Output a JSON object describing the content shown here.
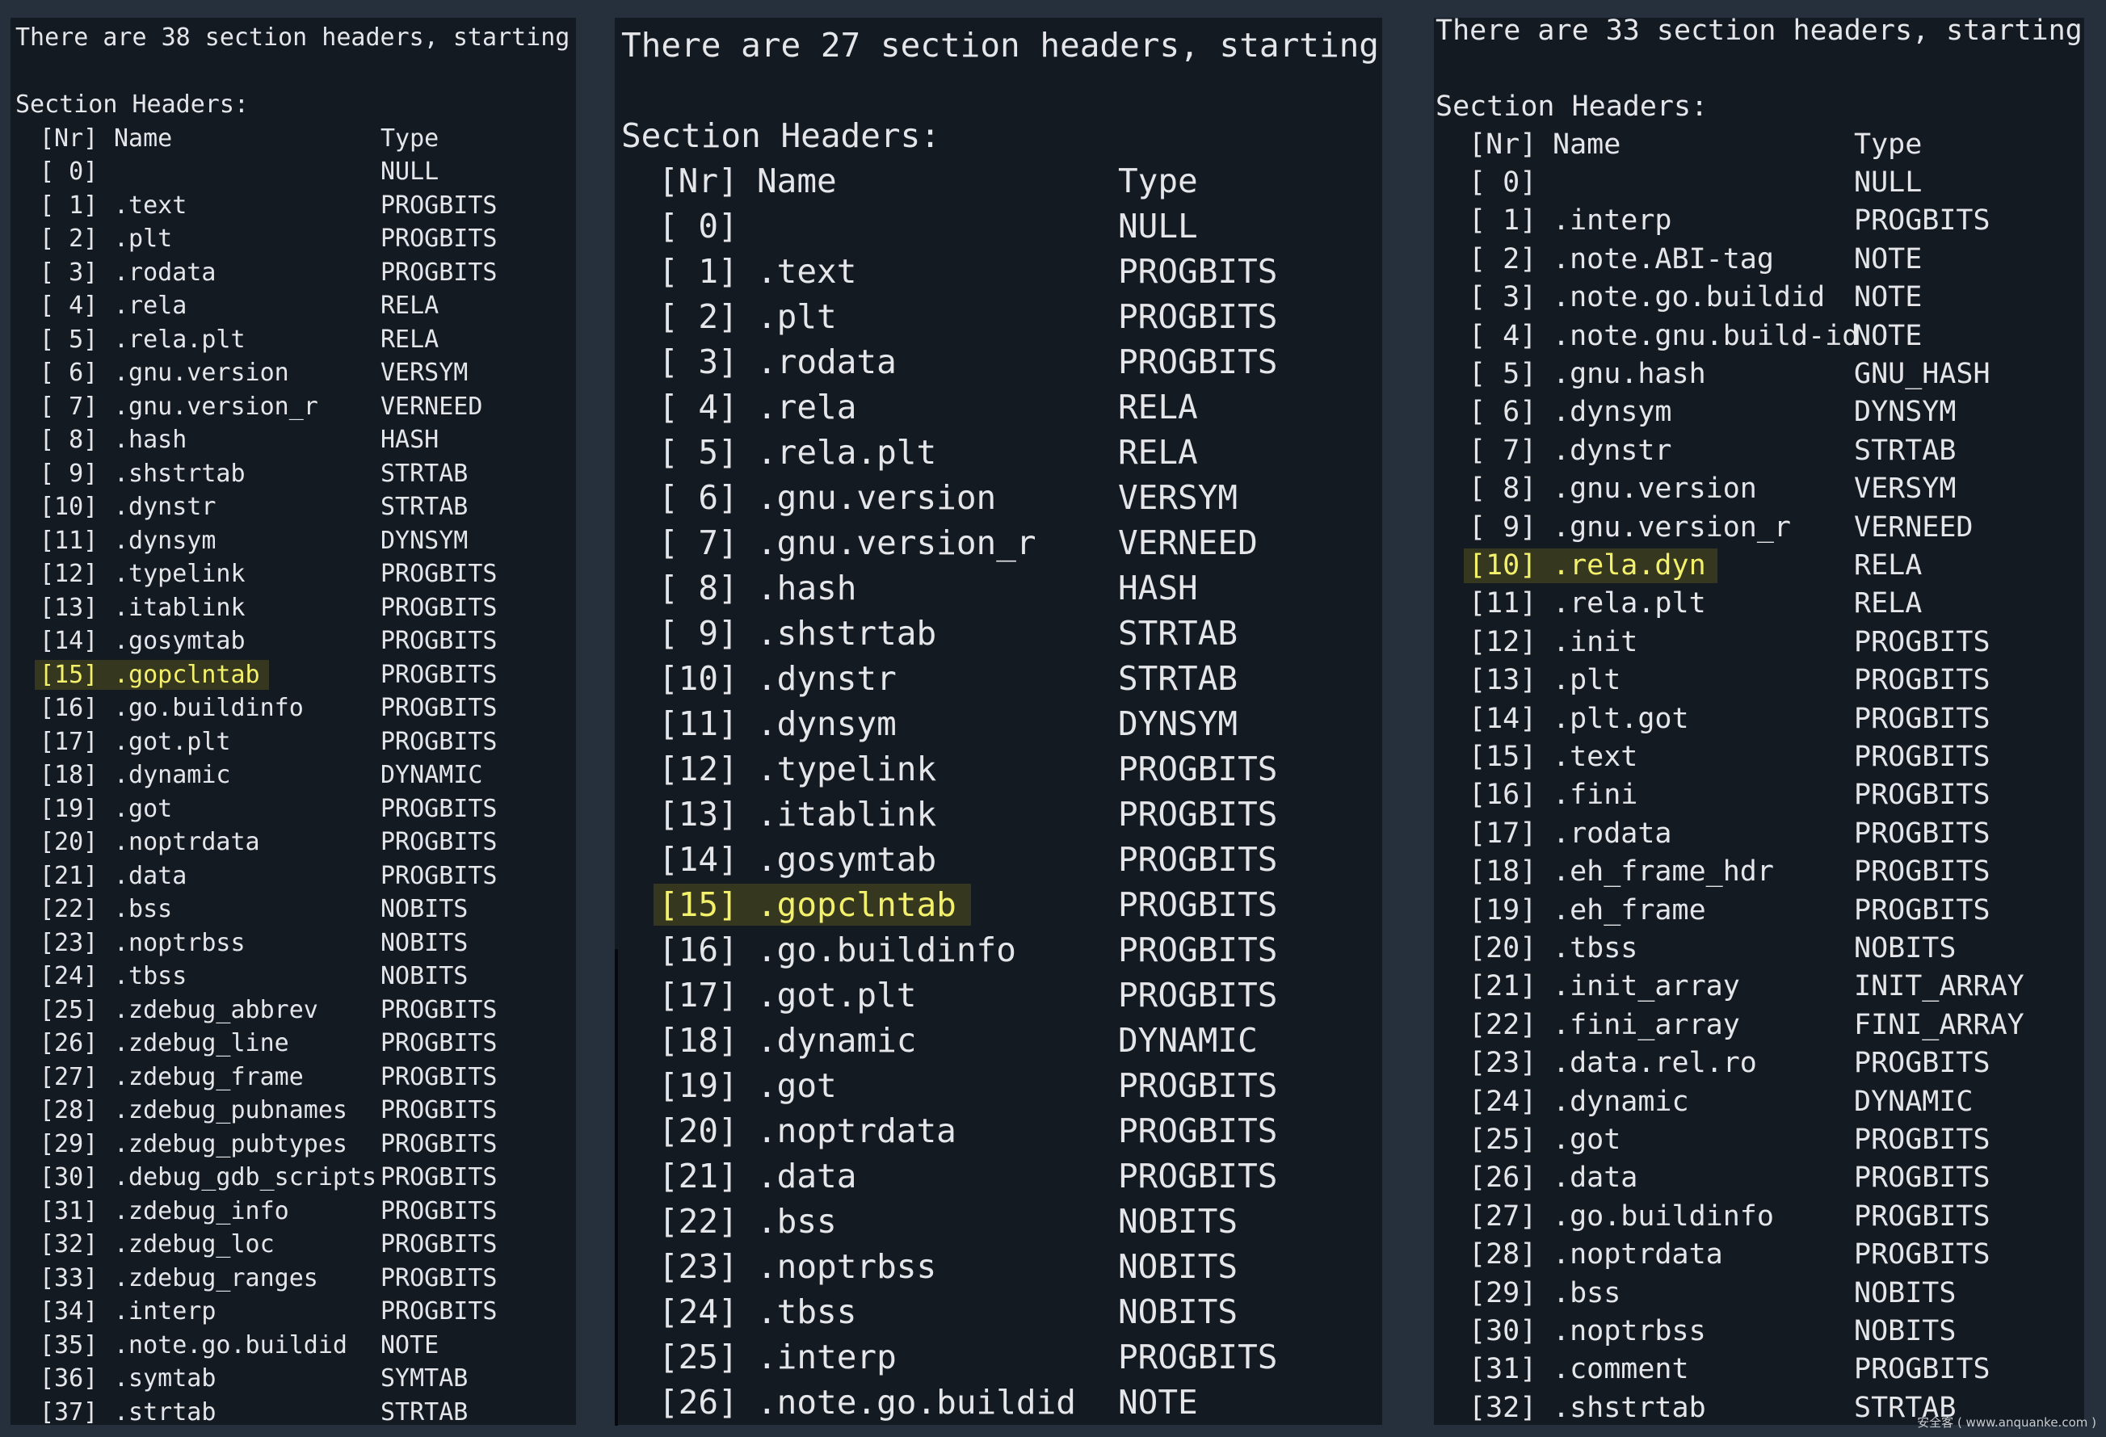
{
  "panels": [
    {
      "summary": "There are 38 section headers, starting",
      "heading": "Section Headers:",
      "columns": {
        "nr": "[Nr]",
        "name": "Name",
        "type": "Type"
      },
      "rows": [
        {
          "nr": "[ 0]",
          "name": "",
          "type": "NULL"
        },
        {
          "nr": "[ 1]",
          "name": ".text",
          "type": "PROGBITS"
        },
        {
          "nr": "[ 2]",
          "name": ".plt",
          "type": "PROGBITS"
        },
        {
          "nr": "[ 3]",
          "name": ".rodata",
          "type": "PROGBITS"
        },
        {
          "nr": "[ 4]",
          "name": ".rela",
          "type": "RELA"
        },
        {
          "nr": "[ 5]",
          "name": ".rela.plt",
          "type": "RELA"
        },
        {
          "nr": "[ 6]",
          "name": ".gnu.version",
          "type": "VERSYM"
        },
        {
          "nr": "[ 7]",
          "name": ".gnu.version_r",
          "type": "VERNEED"
        },
        {
          "nr": "[ 8]",
          "name": ".hash",
          "type": "HASH"
        },
        {
          "nr": "[ 9]",
          "name": ".shstrtab",
          "type": "STRTAB"
        },
        {
          "nr": "[10]",
          "name": ".dynstr",
          "type": "STRTAB"
        },
        {
          "nr": "[11]",
          "name": ".dynsym",
          "type": "DYNSYM"
        },
        {
          "nr": "[12]",
          "name": ".typelink",
          "type": "PROGBITS"
        },
        {
          "nr": "[13]",
          "name": ".itablink",
          "type": "PROGBITS"
        },
        {
          "nr": "[14]",
          "name": ".gosymtab",
          "type": "PROGBITS"
        },
        {
          "nr": "[15]",
          "name": ".gopclntab",
          "type": "PROGBITS",
          "highlight": true
        },
        {
          "nr": "[16]",
          "name": ".go.buildinfo",
          "type": "PROGBITS"
        },
        {
          "nr": "[17]",
          "name": ".got.plt",
          "type": "PROGBITS"
        },
        {
          "nr": "[18]",
          "name": ".dynamic",
          "type": "DYNAMIC"
        },
        {
          "nr": "[19]",
          "name": ".got",
          "type": "PROGBITS"
        },
        {
          "nr": "[20]",
          "name": ".noptrdata",
          "type": "PROGBITS"
        },
        {
          "nr": "[21]",
          "name": ".data",
          "type": "PROGBITS"
        },
        {
          "nr": "[22]",
          "name": ".bss",
          "type": "NOBITS"
        },
        {
          "nr": "[23]",
          "name": ".noptrbss",
          "type": "NOBITS"
        },
        {
          "nr": "[24]",
          "name": ".tbss",
          "type": "NOBITS"
        },
        {
          "nr": "[25]",
          "name": ".zdebug_abbrev",
          "type": "PROGBITS"
        },
        {
          "nr": "[26]",
          "name": ".zdebug_line",
          "type": "PROGBITS"
        },
        {
          "nr": "[27]",
          "name": ".zdebug_frame",
          "type": "PROGBITS"
        },
        {
          "nr": "[28]",
          "name": ".zdebug_pubnames",
          "type": "PROGBITS"
        },
        {
          "nr": "[29]",
          "name": ".zdebug_pubtypes",
          "type": "PROGBITS"
        },
        {
          "nr": "[30]",
          "name": ".debug_gdb_scripts",
          "type": "PROGBITS"
        },
        {
          "nr": "[31]",
          "name": ".zdebug_info",
          "type": "PROGBITS"
        },
        {
          "nr": "[32]",
          "name": ".zdebug_loc",
          "type": "PROGBITS"
        },
        {
          "nr": "[33]",
          "name": ".zdebug_ranges",
          "type": "PROGBITS"
        },
        {
          "nr": "[34]",
          "name": ".interp",
          "type": "PROGBITS"
        },
        {
          "nr": "[35]",
          "name": ".note.go.buildid",
          "type": "NOTE"
        },
        {
          "nr": "[36]",
          "name": ".symtab",
          "type": "SYMTAB"
        },
        {
          "nr": "[37]",
          "name": ".strtab",
          "type": "STRTAB"
        }
      ]
    },
    {
      "summary": "There are 27 section headers, starting",
      "heading": "Section Headers:",
      "columns": {
        "nr": "[Nr]",
        "name": "Name",
        "type": "Type"
      },
      "rows": [
        {
          "nr": "[ 0]",
          "name": "",
          "type": "NULL"
        },
        {
          "nr": "[ 1]",
          "name": ".text",
          "type": "PROGBITS"
        },
        {
          "nr": "[ 2]",
          "name": ".plt",
          "type": "PROGBITS"
        },
        {
          "nr": "[ 3]",
          "name": ".rodata",
          "type": "PROGBITS"
        },
        {
          "nr": "[ 4]",
          "name": ".rela",
          "type": "RELA"
        },
        {
          "nr": "[ 5]",
          "name": ".rela.plt",
          "type": "RELA"
        },
        {
          "nr": "[ 6]",
          "name": ".gnu.version",
          "type": "VERSYM"
        },
        {
          "nr": "[ 7]",
          "name": ".gnu.version_r",
          "type": "VERNEED"
        },
        {
          "nr": "[ 8]",
          "name": ".hash",
          "type": "HASH"
        },
        {
          "nr": "[ 9]",
          "name": ".shstrtab",
          "type": "STRTAB"
        },
        {
          "nr": "[10]",
          "name": ".dynstr",
          "type": "STRTAB"
        },
        {
          "nr": "[11]",
          "name": ".dynsym",
          "type": "DYNSYM"
        },
        {
          "nr": "[12]",
          "name": ".typelink",
          "type": "PROGBITS"
        },
        {
          "nr": "[13]",
          "name": ".itablink",
          "type": "PROGBITS"
        },
        {
          "nr": "[14]",
          "name": ".gosymtab",
          "type": "PROGBITS"
        },
        {
          "nr": "[15]",
          "name": ".gopclntab",
          "type": "PROGBITS",
          "highlight": true
        },
        {
          "nr": "[16]",
          "name": ".go.buildinfo",
          "type": "PROGBITS"
        },
        {
          "nr": "[17]",
          "name": ".got.plt",
          "type": "PROGBITS"
        },
        {
          "nr": "[18]",
          "name": ".dynamic",
          "type": "DYNAMIC"
        },
        {
          "nr": "[19]",
          "name": ".got",
          "type": "PROGBITS"
        },
        {
          "nr": "[20]",
          "name": ".noptrdata",
          "type": "PROGBITS"
        },
        {
          "nr": "[21]",
          "name": ".data",
          "type": "PROGBITS"
        },
        {
          "nr": "[22]",
          "name": ".bss",
          "type": "NOBITS"
        },
        {
          "nr": "[23]",
          "name": ".noptrbss",
          "type": "NOBITS"
        },
        {
          "nr": "[24]",
          "name": ".tbss",
          "type": "NOBITS"
        },
        {
          "nr": "[25]",
          "name": ".interp",
          "type": "PROGBITS"
        },
        {
          "nr": "[26]",
          "name": ".note.go.buildid",
          "type": "NOTE"
        }
      ]
    },
    {
      "summary": "There are 33 section headers, starting",
      "heading": "Section Headers:",
      "columns": {
        "nr": "[Nr]",
        "name": "Name",
        "type": "Type"
      },
      "rows": [
        {
          "nr": "[ 0]",
          "name": "",
          "type": "NULL"
        },
        {
          "nr": "[ 1]",
          "name": ".interp",
          "type": "PROGBITS"
        },
        {
          "nr": "[ 2]",
          "name": ".note.ABI-tag",
          "type": "NOTE"
        },
        {
          "nr": "[ 3]",
          "name": ".note.go.buildid",
          "type": "NOTE"
        },
        {
          "nr": "[ 4]",
          "name": ".note.gnu.build-id",
          "type": "NOTE"
        },
        {
          "nr": "[ 5]",
          "name": ".gnu.hash",
          "type": "GNU_HASH"
        },
        {
          "nr": "[ 6]",
          "name": ".dynsym",
          "type": "DYNSYM"
        },
        {
          "nr": "[ 7]",
          "name": ".dynstr",
          "type": "STRTAB"
        },
        {
          "nr": "[ 8]",
          "name": ".gnu.version",
          "type": "VERSYM"
        },
        {
          "nr": "[ 9]",
          "name": ".gnu.version_r",
          "type": "VERNEED"
        },
        {
          "nr": "[10]",
          "name": ".rela.dyn",
          "type": "RELA",
          "highlight": true
        },
        {
          "nr": "[11]",
          "name": ".rela.plt",
          "type": "RELA"
        },
        {
          "nr": "[12]",
          "name": ".init",
          "type": "PROGBITS"
        },
        {
          "nr": "[13]",
          "name": ".plt",
          "type": "PROGBITS"
        },
        {
          "nr": "[14]",
          "name": ".plt.got",
          "type": "PROGBITS"
        },
        {
          "nr": "[15]",
          "name": ".text",
          "type": "PROGBITS"
        },
        {
          "nr": "[16]",
          "name": ".fini",
          "type": "PROGBITS"
        },
        {
          "nr": "[17]",
          "name": ".rodata",
          "type": "PROGBITS"
        },
        {
          "nr": "[18]",
          "name": ".eh_frame_hdr",
          "type": "PROGBITS"
        },
        {
          "nr": "[19]",
          "name": ".eh_frame",
          "type": "PROGBITS"
        },
        {
          "nr": "[20]",
          "name": ".tbss",
          "type": "NOBITS"
        },
        {
          "nr": "[21]",
          "name": ".init_array",
          "type": "INIT_ARRAY"
        },
        {
          "nr": "[22]",
          "name": ".fini_array",
          "type": "FINI_ARRAY"
        },
        {
          "nr": "[23]",
          "name": ".data.rel.ro",
          "type": "PROGBITS"
        },
        {
          "nr": "[24]",
          "name": ".dynamic",
          "type": "DYNAMIC"
        },
        {
          "nr": "[25]",
          "name": ".got",
          "type": "PROGBITS"
        },
        {
          "nr": "[26]",
          "name": ".data",
          "type": "PROGBITS"
        },
        {
          "nr": "[27]",
          "name": ".go.buildinfo",
          "type": "PROGBITS"
        },
        {
          "nr": "[28]",
          "name": ".noptrdata",
          "type": "PROGBITS"
        },
        {
          "nr": "[29]",
          "name": ".bss",
          "type": "NOBITS"
        },
        {
          "nr": "[30]",
          "name": ".noptrbss",
          "type": "NOBITS"
        },
        {
          "nr": "[31]",
          "name": ".comment",
          "type": "PROGBITS"
        },
        {
          "nr": "[32]",
          "name": ".shstrtab",
          "type": "STRTAB"
        }
      ]
    }
  ],
  "watermark": "安全客 ( www.anquanke.com )",
  "colors": {
    "background": "#26303d",
    "terminal": "#141a22",
    "text": "#e4e6ea",
    "highlight_text": "#f3f06b",
    "highlight_bg": "#35371f"
  }
}
